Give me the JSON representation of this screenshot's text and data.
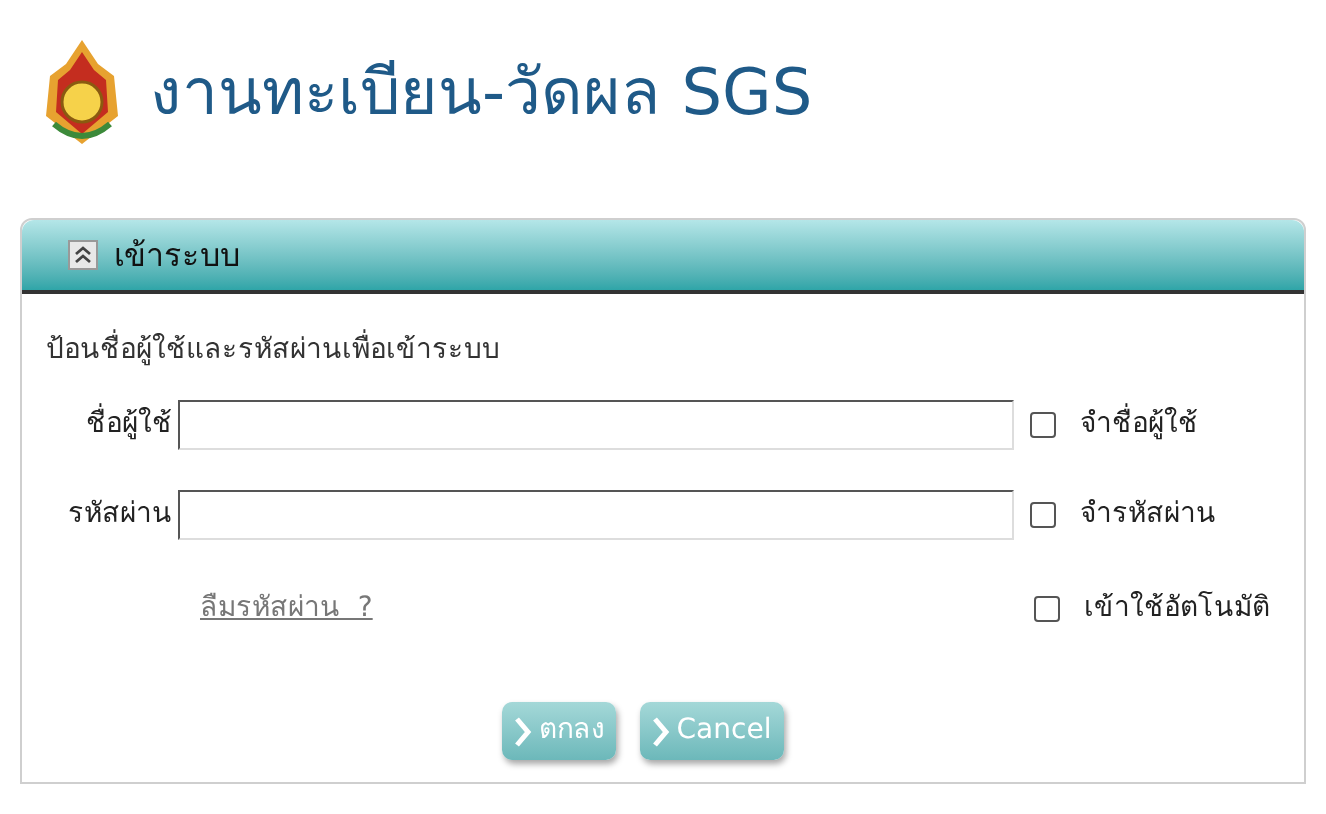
{
  "header": {
    "title": "งานทะเบียน-วัดผล SGS"
  },
  "panel": {
    "title": "เข้าระบบ",
    "instruction": "ป้อนชื่อผู้ใช้และรหัสผ่านเพื่อเข้าระบบ",
    "fields": [
      {
        "label": "ชื่อผู้ใช้",
        "option": {
          "label": "จำชื่อผู้ใช้",
          "checked": false
        }
      },
      {
        "label": "รหัสผ่าน",
        "option": {
          "label": "จำรหัสผ่าน",
          "checked": false
        }
      }
    ],
    "forgot_link": "ลืมรหัสผ่าน  ?",
    "auto_login": {
      "label": "เข้าใช้อัตโนมัติ",
      "checked": false
    },
    "buttons": [
      "ตกลง",
      "Cancel"
    ]
  }
}
